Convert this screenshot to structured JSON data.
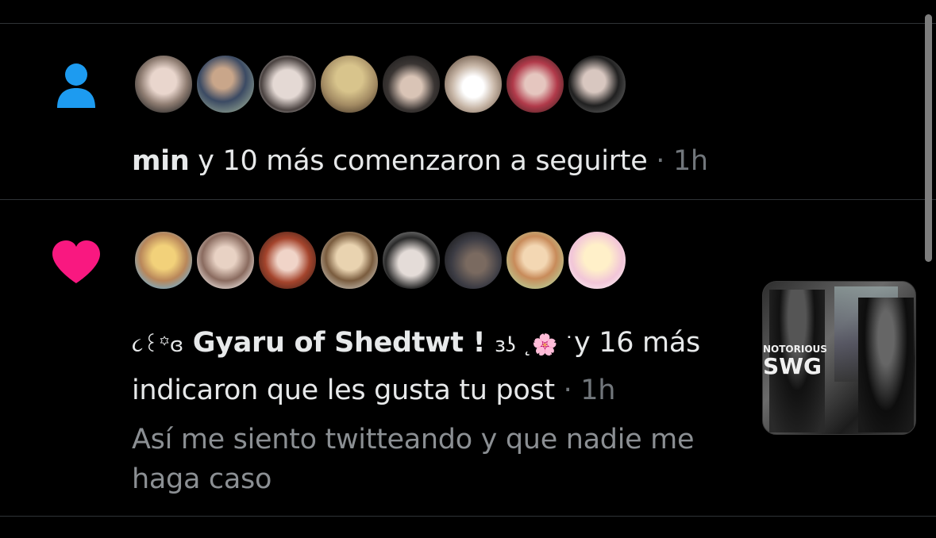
{
  "follow_notification": {
    "lead_user": "min",
    "rest_text": " y 10 más comenzaron a seguirte",
    "separator": " · ",
    "time": "1h",
    "icon": "person-icon",
    "icon_color": "#1d9bf0",
    "avatar_count": 8
  },
  "like_notification": {
    "lead_user_prefix": "૮꒰꙳ɞ",
    "lead_user_name": " Gyaru of Shedtwt ! ",
    "lead_user_suffix": "ɜʖ ˛🌸 ˙",
    "rest_text_1": "y 16 más",
    "rest_text_2": "indicaron que les gusta tu post",
    "separator": " · ",
    "time": "1h",
    "post_line_1": "Así me siento twitteando y que nadie me",
    "post_line_2": "haga caso",
    "icon": "heart-icon",
    "icon_color": "#f91880",
    "avatar_count": 8,
    "thumbnail_text_1": "NOTORIOUS",
    "thumbnail_text_2": "SWG"
  }
}
